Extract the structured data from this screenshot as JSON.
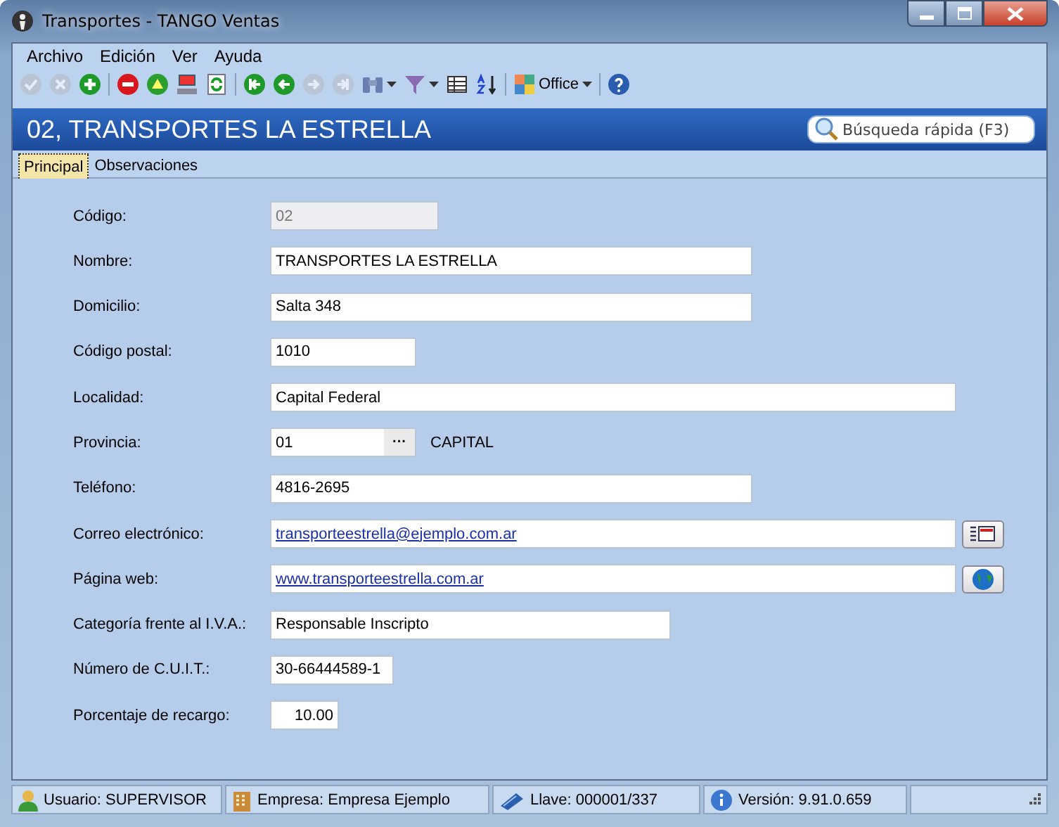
{
  "window": {
    "title": "Transportes - TANGO Ventas"
  },
  "menu": [
    "Archivo",
    "Edición",
    "Ver",
    "Ayuda"
  ],
  "toolbar": [
    {
      "kind": "check",
      "disabled": true
    },
    {
      "kind": "cancel",
      "disabled": true
    },
    {
      "kind": "add",
      "disabled": false
    },
    {
      "kind": "separator"
    },
    {
      "kind": "delete",
      "disabled": false
    },
    {
      "kind": "up",
      "disabled": false
    },
    {
      "kind": "computer",
      "disabled": false
    },
    {
      "kind": "refresh",
      "disabled": false
    },
    {
      "kind": "separator"
    },
    {
      "kind": "first",
      "disabled": false
    },
    {
      "kind": "prev",
      "disabled": false
    },
    {
      "kind": "next",
      "disabled": true
    },
    {
      "kind": "last",
      "disabled": true
    },
    {
      "kind": "binoculars",
      "disabled": false,
      "dropdown": true
    },
    {
      "kind": "filter",
      "disabled": false,
      "dropdown": true
    },
    {
      "kind": "grid",
      "disabled": false
    },
    {
      "kind": "sort",
      "disabled": false
    },
    {
      "kind": "separator"
    },
    {
      "kind": "office",
      "disabled": false,
      "dropdown": true,
      "label": "Office"
    },
    {
      "kind": "separator"
    },
    {
      "kind": "help",
      "disabled": false
    }
  ],
  "header": {
    "title": "02, TRANSPORTES LA ESTRELLA",
    "search": {
      "placeholder": "Búsqueda rápida (F3)"
    }
  },
  "tabs": [
    {
      "label": "Principal",
      "selected": true
    },
    {
      "label": "Observaciones",
      "selected": false
    }
  ],
  "fields": [
    {
      "label": "Código:",
      "value": "02",
      "kind": "text",
      "disabled": true
    },
    {
      "label": "Nombre:",
      "value": "TRANSPORTES LA ESTRELLA",
      "kind": "text",
      "disabled": false
    },
    {
      "label": "Domicilio:",
      "value": "Salta 348",
      "kind": "text",
      "disabled": false
    },
    {
      "label": "Código postal:",
      "value": "1010",
      "kind": "text",
      "disabled": false
    },
    {
      "label": "Localidad:",
      "value": "Capital Federal",
      "kind": "text",
      "disabled": false
    },
    {
      "label": "Provincia:",
      "value": "01",
      "kind": "lookup",
      "disabled": false,
      "lookup_button": "···",
      "description": "CAPITAL"
    },
    {
      "label": "Teléfono:",
      "value": "4816-2695",
      "kind": "text",
      "disabled": false
    },
    {
      "label": "Correo electrónico:",
      "value": "transporteestrella@ejemplo.com.ar",
      "kind": "email",
      "disabled": false
    },
    {
      "label": "Página web:",
      "value": "www.transporteestrella.com.ar",
      "kind": "web",
      "disabled": false
    },
    {
      "label": "Categoría frente al I.V.A.:",
      "value": "Responsable Inscripto",
      "kind": "text",
      "disabled": false
    },
    {
      "label": "Número de C.U.I.T.:",
      "value": "30-66444589-1",
      "kind": "text",
      "disabled": false
    },
    {
      "label": "Porcentaje de recargo:",
      "value": "10.00",
      "kind": "number",
      "disabled": false
    }
  ],
  "status_bar": [
    {
      "kind": "user",
      "text": "Usuario: SUPERVISOR"
    },
    {
      "kind": "company",
      "text": "Empresa: Empresa Ejemplo"
    },
    {
      "kind": "key",
      "text": "Llave: 000001/337"
    },
    {
      "kind": "info",
      "text": "Versión: 9.91.0.659"
    }
  ]
}
